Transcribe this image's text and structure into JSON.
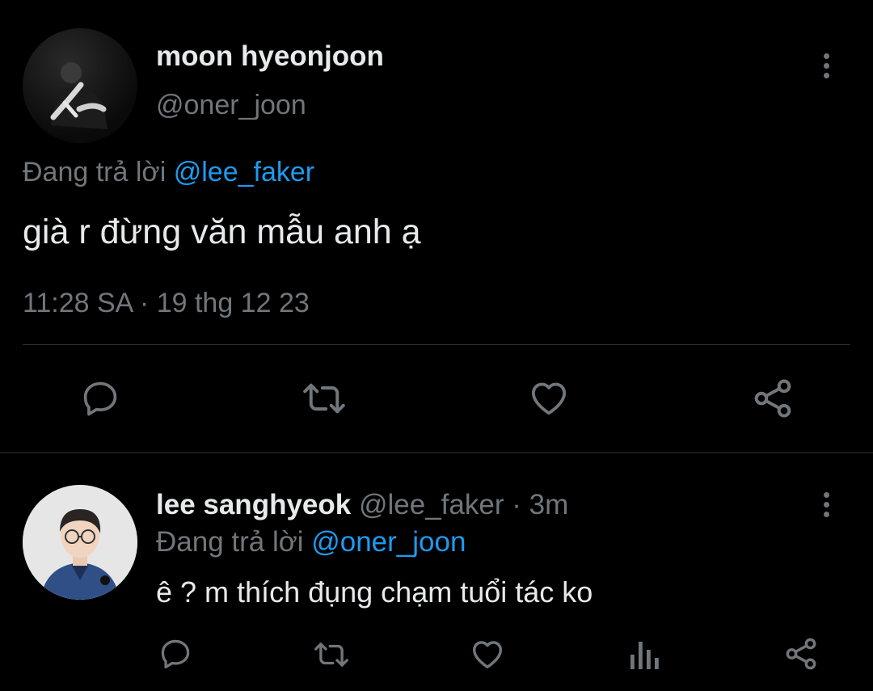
{
  "main_tweet": {
    "display_name": "moon hyeonjoon",
    "handle": "@oner_joon",
    "replying_prefix": "Đang trả lời",
    "replying_to": "@lee_faker",
    "text": "già r đừng văn mẫu anh ạ",
    "timestamp": "11:28 SA · 19 thg 12 23",
    "actions": [
      "comment-icon",
      "retweet-icon",
      "like-icon",
      "share-icon"
    ]
  },
  "reply": {
    "display_name": "lee sanghyeok",
    "handle": "@lee_faker",
    "separator": "·",
    "age": "3m",
    "replying_prefix": "Đang trả lời",
    "replying_to": "@oner_joon",
    "text": "ê ? m thích đụng chạm tuổi tác ko",
    "actions": [
      "comment-icon",
      "retweet-icon",
      "like-icon",
      "analytics-icon",
      "share-icon"
    ]
  },
  "colors": {
    "background": "#000000",
    "text": "#e7e9ea",
    "muted": "#71767b",
    "link": "#1d9bf0"
  }
}
